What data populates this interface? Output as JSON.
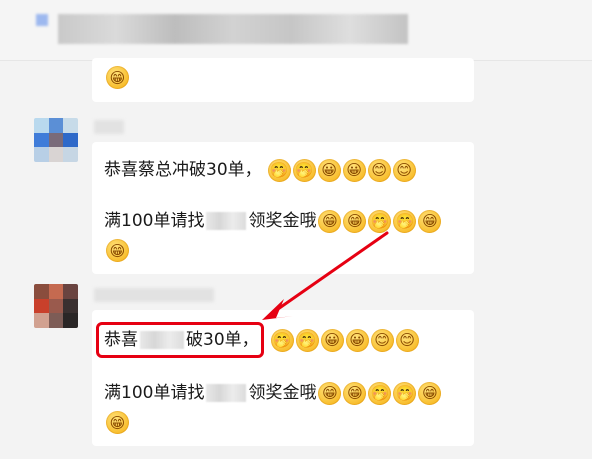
{
  "messages": [
    {
      "line1_text": "恭喜蔡总冲破30单，",
      "line2_prefix": "满100单请找",
      "line2_suffix": "领奖金哦"
    },
    {
      "line1_prefix": "恭喜",
      "line1_suffix": "破30单，",
      "line2_prefix": "满100单请找",
      "line2_suffix": "领奖金哦"
    }
  ],
  "emoji": {
    "line1_sequence": [
      "🤭",
      "🤭",
      "😀",
      "😀",
      "😊",
      "😊"
    ],
    "line2_sequence": [
      "😁",
      "😁",
      "🤭",
      "🤭",
      "😁"
    ],
    "trailing": "😁",
    "top_trailing": "😁"
  },
  "annotation": {
    "highlight_color": "#e60012",
    "arrow_color": "#e60012"
  }
}
